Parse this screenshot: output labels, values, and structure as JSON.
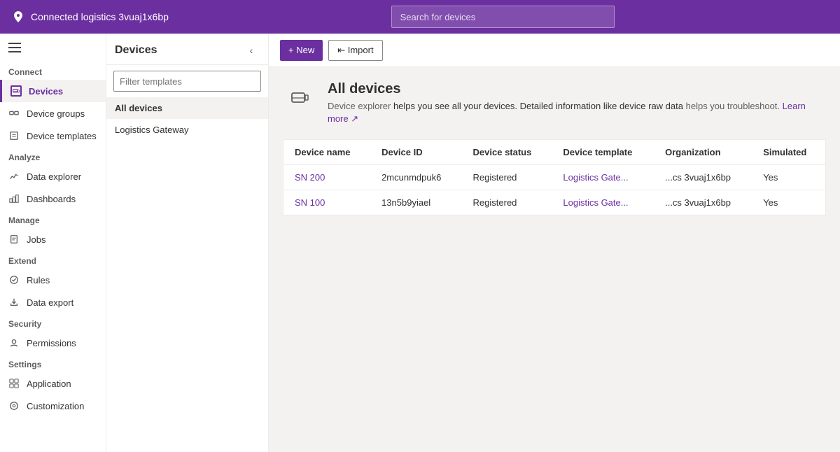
{
  "topbar": {
    "app_name": "Connected logistics 3vuaj1x6bp",
    "search_placeholder": "Search for devices"
  },
  "sidebar": {
    "sections": [
      {
        "label": "Connect",
        "items": [
          {
            "id": "devices",
            "label": "Devices",
            "active": true
          },
          {
            "id": "device-groups",
            "label": "Device groups",
            "active": false
          },
          {
            "id": "device-templates",
            "label": "Device templates",
            "active": false
          }
        ]
      },
      {
        "label": "Analyze",
        "items": [
          {
            "id": "data-explorer",
            "label": "Data explorer",
            "active": false
          },
          {
            "id": "dashboards",
            "label": "Dashboards",
            "active": false
          }
        ]
      },
      {
        "label": "Manage",
        "items": [
          {
            "id": "jobs",
            "label": "Jobs",
            "active": false
          }
        ]
      },
      {
        "label": "Extend",
        "items": [
          {
            "id": "rules",
            "label": "Rules",
            "active": false
          },
          {
            "id": "data-export",
            "label": "Data export",
            "active": false
          }
        ]
      },
      {
        "label": "Security",
        "items": [
          {
            "id": "permissions",
            "label": "Permissions",
            "active": false
          }
        ]
      },
      {
        "label": "Settings",
        "items": [
          {
            "id": "application",
            "label": "Application",
            "active": false
          },
          {
            "id": "customization",
            "label": "Customization",
            "active": false
          }
        ]
      }
    ]
  },
  "devices_panel": {
    "title": "Devices",
    "filter_placeholder": "Filter templates",
    "nav_items": [
      {
        "label": "All devices",
        "selected": true
      },
      {
        "label": "Logistics Gateway",
        "selected": false
      }
    ]
  },
  "toolbar": {
    "new_label": "+ New",
    "import_label": "⇤ Import"
  },
  "content": {
    "heading": "All devices",
    "description_part1": "Device explorer ",
    "description_highlight1": "helps you see all your devices. Detailed information like device raw data ",
    "description_part2": "helps you troubleshoot. ",
    "learn_more": "Learn more ↗",
    "table": {
      "columns": [
        "Device name",
        "Device ID",
        "Device status",
        "Device template",
        "Organization",
        "Simulated"
      ],
      "rows": [
        {
          "device_name": "SN 200",
          "device_id": "2mcunmdpuk6",
          "device_status": "Registered",
          "device_template": "Logistics Gate...",
          "organization": "...cs 3vuaj1x6bp",
          "simulated": "Yes"
        },
        {
          "device_name": "SN 100",
          "device_id": "13n5b9yiael",
          "device_status": "Registered",
          "device_template": "Logistics Gate...",
          "organization": "...cs 3vuaj1x6bp",
          "simulated": "Yes"
        }
      ]
    }
  }
}
